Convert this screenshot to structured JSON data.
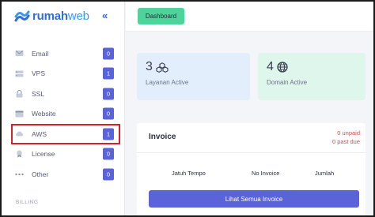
{
  "brand": {
    "name_bold": "rumah",
    "name_light": "web"
  },
  "sidebar": {
    "items": [
      {
        "label": "Email",
        "count": "0",
        "icon": "email-icon"
      },
      {
        "label": "VPS",
        "count": "1",
        "icon": "server-icon"
      },
      {
        "label": "SSL",
        "count": "0",
        "icon": "lock-icon"
      },
      {
        "label": "Website",
        "count": "0",
        "icon": "window-icon"
      },
      {
        "label": "AWS",
        "count": "1",
        "icon": "cloud-icon"
      },
      {
        "label": "License",
        "count": "0",
        "icon": "license-icon"
      },
      {
        "label": "Other",
        "count": "0",
        "icon": "more-icon"
      }
    ],
    "section_billing": "BILLING"
  },
  "topbar": {
    "dashboard_label": "Dashboard"
  },
  "stats": {
    "layanan": {
      "value": "3",
      "caption": "Layanan Active"
    },
    "domain": {
      "value": "4",
      "caption": "Domain Active"
    }
  },
  "invoice": {
    "title": "Invoice",
    "unpaid": "0 unpaid",
    "past_due": "0 past due",
    "headers": [
      "Jatuh Tempo",
      "No Invoice",
      "Jumlah"
    ],
    "button_label": "Lihat Semua Invoice"
  },
  "colors": {
    "accent": "#5a63d8",
    "brand": "#2f6fd6",
    "dashboard_button": "#4ed39a",
    "highlight_border": "#d6202b",
    "alert": "#e0483f"
  }
}
